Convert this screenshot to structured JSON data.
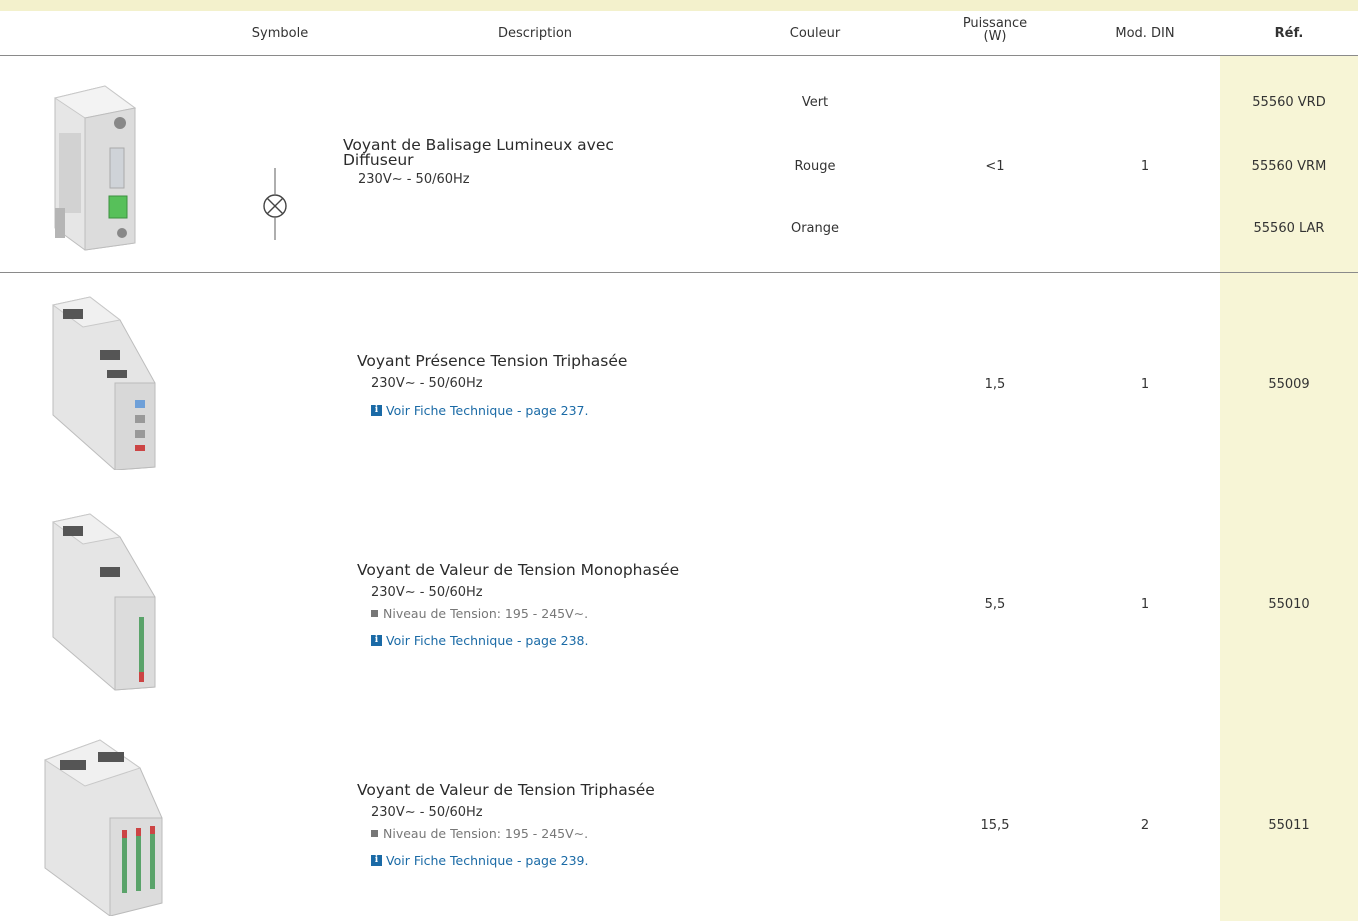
{
  "header": {
    "symbole": "Symbole",
    "description": "Description",
    "couleur": "Couleur",
    "puissance_line1": "Puissance",
    "puissance_line2": "(W)",
    "mod_din": "Mod. DIN",
    "ref": "Réf."
  },
  "rows": [
    {
      "title": "Voyant de Balisage Lumineux avec Diffuseur",
      "title_line1": "Voyant de Balisage Lumineux avec",
      "title_line2": "Diffuseur",
      "voltage": "230V∼ - 50/60Hz",
      "colors": [
        "Vert",
        "Rouge",
        "Orange"
      ],
      "puissance": "<1",
      "mod_din": "1",
      "refs": [
        "55560 VRD",
        "55560 VRM",
        "55560 LAR"
      ]
    },
    {
      "title": "Voyant Présence Tension Triphasée",
      "voltage": "230V∼ - 50/60Hz",
      "link": "Voir Fiche Technique - page 237.",
      "puissance": "1,5",
      "mod_din": "1",
      "ref": "55009"
    },
    {
      "title": "Voyant de Valeur de Tension Monophasée",
      "voltage": "230V∼ - 50/60Hz",
      "note": "Niveau de Tension: 195 - 245V∼.",
      "link": "Voir Fiche Technique - page 238.",
      "puissance": "5,5",
      "mod_din": "1",
      "ref": "55010"
    },
    {
      "title": "Voyant de Valeur de Tension Triphasée",
      "voltage": "230V∼ - 50/60Hz",
      "note": "Niveau de Tension: 195 - 245V∼.",
      "link": "Voir Fiche Technique - page 239.",
      "puissance": "15,5",
      "mod_din": "2",
      "ref": "55011"
    }
  ],
  "icons": {
    "info": "i",
    "symbol": "lamp-symbol-icon"
  },
  "colors": {
    "ref_column_bg": "#f7f5d6",
    "top_band": "#f3f1cc",
    "link": "#1a6aa6"
  }
}
